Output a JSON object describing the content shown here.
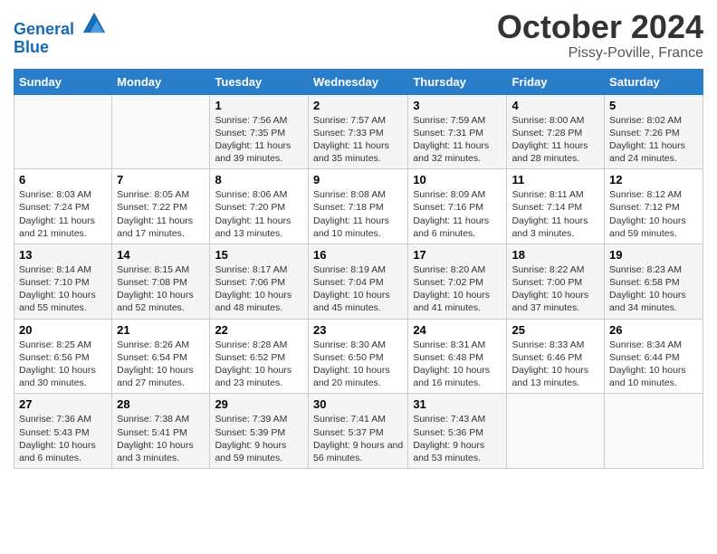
{
  "header": {
    "logo_line1": "General",
    "logo_line2": "Blue",
    "month": "October 2024",
    "location": "Pissy-Poville, France"
  },
  "days_of_week": [
    "Sunday",
    "Monday",
    "Tuesday",
    "Wednesday",
    "Thursday",
    "Friday",
    "Saturday"
  ],
  "weeks": [
    [
      {
        "day": "",
        "sunrise": "",
        "sunset": "",
        "daylight": ""
      },
      {
        "day": "",
        "sunrise": "",
        "sunset": "",
        "daylight": ""
      },
      {
        "day": "1",
        "sunrise": "Sunrise: 7:56 AM",
        "sunset": "Sunset: 7:35 PM",
        "daylight": "Daylight: 11 hours and 39 minutes."
      },
      {
        "day": "2",
        "sunrise": "Sunrise: 7:57 AM",
        "sunset": "Sunset: 7:33 PM",
        "daylight": "Daylight: 11 hours and 35 minutes."
      },
      {
        "day": "3",
        "sunrise": "Sunrise: 7:59 AM",
        "sunset": "Sunset: 7:31 PM",
        "daylight": "Daylight: 11 hours and 32 minutes."
      },
      {
        "day": "4",
        "sunrise": "Sunrise: 8:00 AM",
        "sunset": "Sunset: 7:28 PM",
        "daylight": "Daylight: 11 hours and 28 minutes."
      },
      {
        "day": "5",
        "sunrise": "Sunrise: 8:02 AM",
        "sunset": "Sunset: 7:26 PM",
        "daylight": "Daylight: 11 hours and 24 minutes."
      }
    ],
    [
      {
        "day": "6",
        "sunrise": "Sunrise: 8:03 AM",
        "sunset": "Sunset: 7:24 PM",
        "daylight": "Daylight: 11 hours and 21 minutes."
      },
      {
        "day": "7",
        "sunrise": "Sunrise: 8:05 AM",
        "sunset": "Sunset: 7:22 PM",
        "daylight": "Daylight: 11 hours and 17 minutes."
      },
      {
        "day": "8",
        "sunrise": "Sunrise: 8:06 AM",
        "sunset": "Sunset: 7:20 PM",
        "daylight": "Daylight: 11 hours and 13 minutes."
      },
      {
        "day": "9",
        "sunrise": "Sunrise: 8:08 AM",
        "sunset": "Sunset: 7:18 PM",
        "daylight": "Daylight: 11 hours and 10 minutes."
      },
      {
        "day": "10",
        "sunrise": "Sunrise: 8:09 AM",
        "sunset": "Sunset: 7:16 PM",
        "daylight": "Daylight: 11 hours and 6 minutes."
      },
      {
        "day": "11",
        "sunrise": "Sunrise: 8:11 AM",
        "sunset": "Sunset: 7:14 PM",
        "daylight": "Daylight: 11 hours and 3 minutes."
      },
      {
        "day": "12",
        "sunrise": "Sunrise: 8:12 AM",
        "sunset": "Sunset: 7:12 PM",
        "daylight": "Daylight: 10 hours and 59 minutes."
      }
    ],
    [
      {
        "day": "13",
        "sunrise": "Sunrise: 8:14 AM",
        "sunset": "Sunset: 7:10 PM",
        "daylight": "Daylight: 10 hours and 55 minutes."
      },
      {
        "day": "14",
        "sunrise": "Sunrise: 8:15 AM",
        "sunset": "Sunset: 7:08 PM",
        "daylight": "Daylight: 10 hours and 52 minutes."
      },
      {
        "day": "15",
        "sunrise": "Sunrise: 8:17 AM",
        "sunset": "Sunset: 7:06 PM",
        "daylight": "Daylight: 10 hours and 48 minutes."
      },
      {
        "day": "16",
        "sunrise": "Sunrise: 8:19 AM",
        "sunset": "Sunset: 7:04 PM",
        "daylight": "Daylight: 10 hours and 45 minutes."
      },
      {
        "day": "17",
        "sunrise": "Sunrise: 8:20 AM",
        "sunset": "Sunset: 7:02 PM",
        "daylight": "Daylight: 10 hours and 41 minutes."
      },
      {
        "day": "18",
        "sunrise": "Sunrise: 8:22 AM",
        "sunset": "Sunset: 7:00 PM",
        "daylight": "Daylight: 10 hours and 37 minutes."
      },
      {
        "day": "19",
        "sunrise": "Sunrise: 8:23 AM",
        "sunset": "Sunset: 6:58 PM",
        "daylight": "Daylight: 10 hours and 34 minutes."
      }
    ],
    [
      {
        "day": "20",
        "sunrise": "Sunrise: 8:25 AM",
        "sunset": "Sunset: 6:56 PM",
        "daylight": "Daylight: 10 hours and 30 minutes."
      },
      {
        "day": "21",
        "sunrise": "Sunrise: 8:26 AM",
        "sunset": "Sunset: 6:54 PM",
        "daylight": "Daylight: 10 hours and 27 minutes."
      },
      {
        "day": "22",
        "sunrise": "Sunrise: 8:28 AM",
        "sunset": "Sunset: 6:52 PM",
        "daylight": "Daylight: 10 hours and 23 minutes."
      },
      {
        "day": "23",
        "sunrise": "Sunrise: 8:30 AM",
        "sunset": "Sunset: 6:50 PM",
        "daylight": "Daylight: 10 hours and 20 minutes."
      },
      {
        "day": "24",
        "sunrise": "Sunrise: 8:31 AM",
        "sunset": "Sunset: 6:48 PM",
        "daylight": "Daylight: 10 hours and 16 minutes."
      },
      {
        "day": "25",
        "sunrise": "Sunrise: 8:33 AM",
        "sunset": "Sunset: 6:46 PM",
        "daylight": "Daylight: 10 hours and 13 minutes."
      },
      {
        "day": "26",
        "sunrise": "Sunrise: 8:34 AM",
        "sunset": "Sunset: 6:44 PM",
        "daylight": "Daylight: 10 hours and 10 minutes."
      }
    ],
    [
      {
        "day": "27",
        "sunrise": "Sunrise: 7:36 AM",
        "sunset": "Sunset: 5:43 PM",
        "daylight": "Daylight: 10 hours and 6 minutes."
      },
      {
        "day": "28",
        "sunrise": "Sunrise: 7:38 AM",
        "sunset": "Sunset: 5:41 PM",
        "daylight": "Daylight: 10 hours and 3 minutes."
      },
      {
        "day": "29",
        "sunrise": "Sunrise: 7:39 AM",
        "sunset": "Sunset: 5:39 PM",
        "daylight": "Daylight: 9 hours and 59 minutes."
      },
      {
        "day": "30",
        "sunrise": "Sunrise: 7:41 AM",
        "sunset": "Sunset: 5:37 PM",
        "daylight": "Daylight: 9 hours and 56 minutes."
      },
      {
        "day": "31",
        "sunrise": "Sunrise: 7:43 AM",
        "sunset": "Sunset: 5:36 PM",
        "daylight": "Daylight: 9 hours and 53 minutes."
      },
      {
        "day": "",
        "sunrise": "",
        "sunset": "",
        "daylight": ""
      },
      {
        "day": "",
        "sunrise": "",
        "sunset": "",
        "daylight": ""
      }
    ]
  ]
}
